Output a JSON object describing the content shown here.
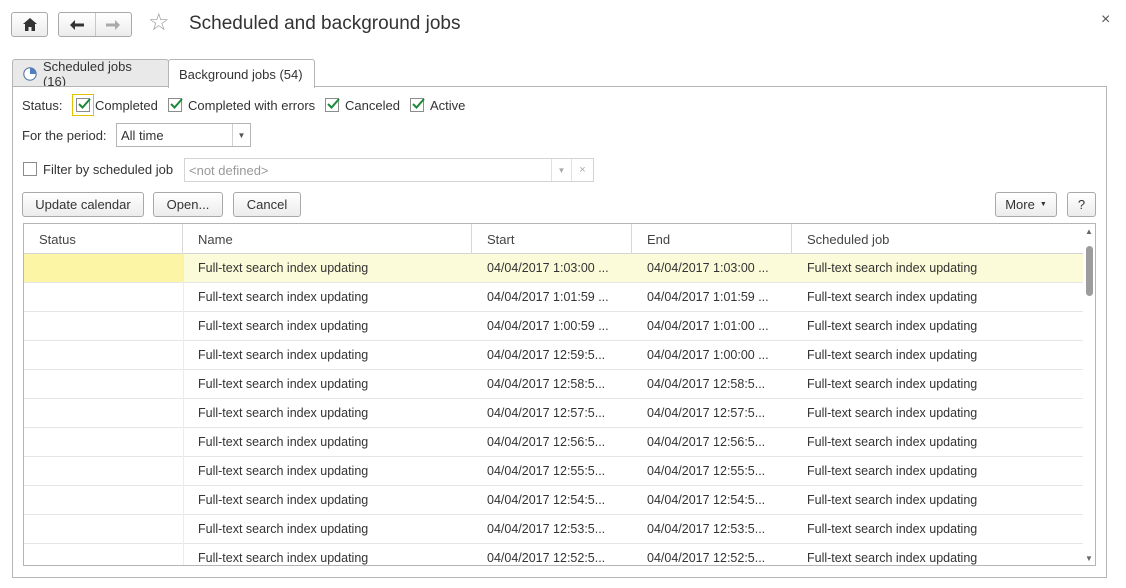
{
  "window": {
    "title": "Scheduled and background jobs",
    "close_glyph": "×"
  },
  "tabs": [
    {
      "label": "Scheduled jobs (16)"
    },
    {
      "label": "Background jobs (54)"
    }
  ],
  "filters": {
    "status_label": "Status:",
    "statuses": [
      {
        "label": "Completed",
        "checked": true
      },
      {
        "label": "Completed with errors",
        "checked": true
      },
      {
        "label": "Canceled",
        "checked": true
      },
      {
        "label": "Active",
        "checked": true
      }
    ],
    "period_label": "For the period:",
    "period_value": "All time",
    "filter_by_job_label": "Filter by scheduled job",
    "filter_by_job_checked": false,
    "filter_by_job_placeholder": "<not defined>"
  },
  "toolbar": {
    "update_calendar": "Update calendar",
    "open": "Open...",
    "cancel": "Cancel",
    "more": "More",
    "help": "?"
  },
  "table": {
    "columns": [
      "Status",
      "Name",
      "Start",
      "End",
      "Scheduled job"
    ],
    "rows": [
      {
        "status": "",
        "name": "Full-text search index updating",
        "start": "04/04/2017 1:03:00 ...",
        "end": "04/04/2017 1:03:00 ...",
        "job": "Full-text search index updating"
      },
      {
        "status": "",
        "name": "Full-text search index updating",
        "start": "04/04/2017 1:01:59 ...",
        "end": "04/04/2017 1:01:59 ...",
        "job": "Full-text search index updating"
      },
      {
        "status": "",
        "name": "Full-text search index updating",
        "start": "04/04/2017 1:00:59 ...",
        "end": "04/04/2017 1:01:00 ...",
        "job": "Full-text search index updating"
      },
      {
        "status": "",
        "name": "Full-text search index updating",
        "start": "04/04/2017 12:59:5...",
        "end": "04/04/2017 1:00:00 ...",
        "job": "Full-text search index updating"
      },
      {
        "status": "",
        "name": "Full-text search index updating",
        "start": "04/04/2017 12:58:5...",
        "end": "04/04/2017 12:58:5...",
        "job": "Full-text search index updating"
      },
      {
        "status": "",
        "name": "Full-text search index updating",
        "start": "04/04/2017 12:57:5...",
        "end": "04/04/2017 12:57:5...",
        "job": "Full-text search index updating"
      },
      {
        "status": "",
        "name": "Full-text search index updating",
        "start": "04/04/2017 12:56:5...",
        "end": "04/04/2017 12:56:5...",
        "job": "Full-text search index updating"
      },
      {
        "status": "",
        "name": "Full-text search index updating",
        "start": "04/04/2017 12:55:5...",
        "end": "04/04/2017 12:55:5...",
        "job": "Full-text search index updating"
      },
      {
        "status": "",
        "name": "Full-text search index updating",
        "start": "04/04/2017 12:54:5...",
        "end": "04/04/2017 12:54:5...",
        "job": "Full-text search index updating"
      },
      {
        "status": "",
        "name": "Full-text search index updating",
        "start": "04/04/2017 12:53:5...",
        "end": "04/04/2017 12:53:5...",
        "job": "Full-text search index updating"
      },
      {
        "status": "",
        "name": "Full-text search index updating",
        "start": "04/04/2017 12:52:5...",
        "end": "04/04/2017 12:52:5...",
        "job": "Full-text search index updating"
      }
    ],
    "selected_row": 0
  },
  "colors": {
    "selected_row": "#fbfbd9",
    "selected_status_cell": "#fdf5a6",
    "checkmark": "#1a8a3a",
    "focus_outline": "#e2c200"
  },
  "icons": [
    "home-icon",
    "back-arrow-icon",
    "forward-arrow-icon",
    "star-icon",
    "close-icon",
    "clock-icon",
    "checkbox-checked-icon",
    "dropdown-arrow-icon",
    "clear-icon",
    "scroll-up-icon",
    "scroll-down-icon"
  ]
}
